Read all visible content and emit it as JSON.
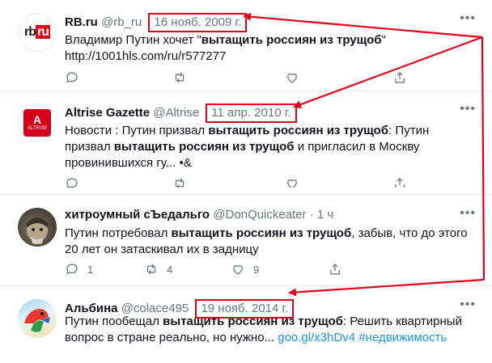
{
  "more_label": "•••",
  "tweets": [
    {
      "name": "RB.ru",
      "handle": "@rb_ru",
      "date": "16 нояб. 2009 г.",
      "text_plain": "Владимир Путин хочет \"",
      "text_bold": "вытащить россиян из трущоб",
      "text_tail": "\"",
      "link": "http://1001hls.com/ru/r577277",
      "avatar_text": "rbru"
    },
    {
      "name": "Altrise Gazette",
      "handle": "@Altrise",
      "date": "11 апр. 2010 г.",
      "t1": "Новости : Путин призвал ",
      "b1": "вытащить россиян из трущоб",
      "t2": ": Путин призвал ",
      "b2": "вытащить россиян из трущоб",
      "t3": " и пригласил в Москву провинившихся гу...  •&",
      "avatar_text": "ALTRISE"
    },
    {
      "name": "хитроумный сЪедальго",
      "handle": "@DonQuickeater",
      "sep": "·",
      "time": "1 ч",
      "t1": "Путин потребовал ",
      "b1": "вытащить россиян из трущоб",
      "t2": ", забыв, что до этого 20 лет он затаскивал их в задницу",
      "replies": "1",
      "retweets": "4",
      "likes": "9"
    },
    {
      "name": "Альбина",
      "handle": "@colace495",
      "date": "19 нояб. 2014 г.",
      "t1": "Путин пообещал ",
      "b1": "вытащить россиян из трущоб",
      "t2": ": Решить квартирный вопрос в стране реально, но нужно... ",
      "link": "goo.gl/x3hDv4",
      "hashtag": "#недвижимость"
    }
  ],
  "colors": {
    "accent_red": "#e0001a",
    "link_blue": "#1b95e0",
    "muted": "#657786"
  }
}
